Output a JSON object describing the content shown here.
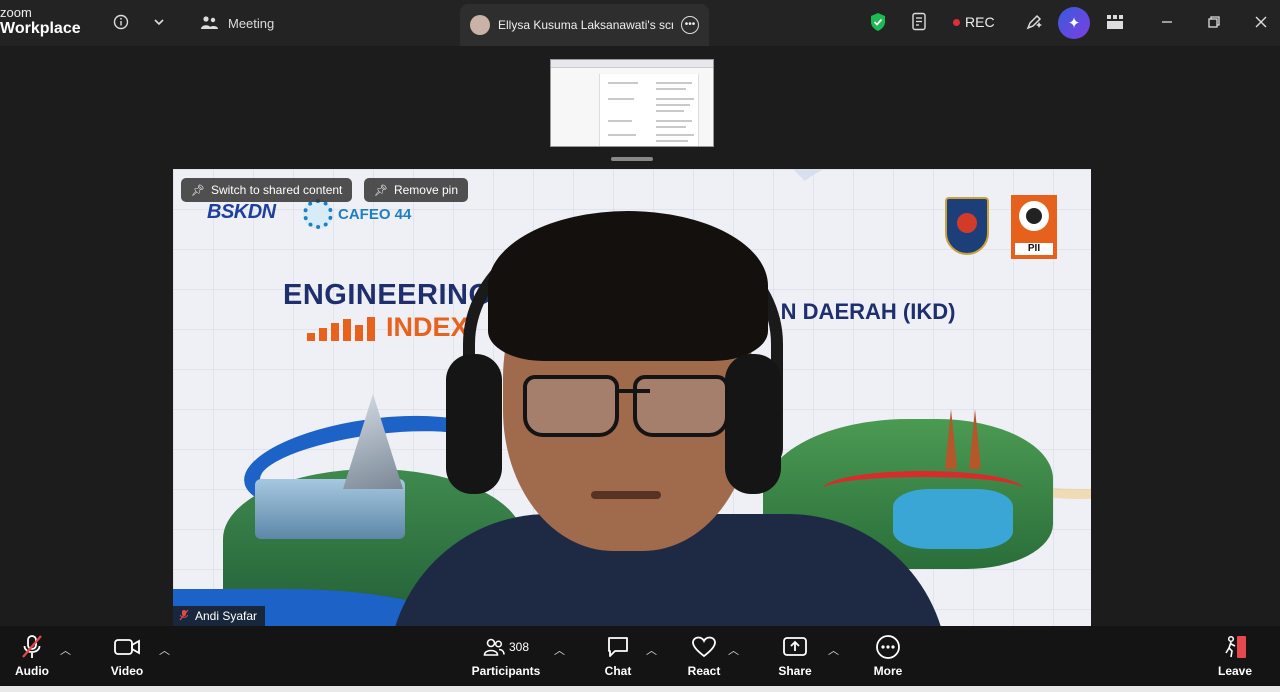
{
  "app": {
    "brand_line1": "zoom",
    "brand_line2": "Workplace"
  },
  "titlebar": {
    "meeting_tab_label": "Meeting",
    "share_tab_label": "Ellysa Kusuma Laksanawati's scree",
    "rec_label": "REC"
  },
  "video": {
    "switch_button": "Switch to shared content",
    "remove_pin_button": "Remove pin",
    "participant_name": "Andi Syafar",
    "slide": {
      "logo_bskdn": "BSKDN",
      "logo_cafeo": "CAFEO 44",
      "title_engineering": "ENGINEERING",
      "title_index": "INDEX",
      "title_ikd": "URAN DAERAH (IKD)",
      "pii_label": "PII"
    }
  },
  "toolbar": {
    "audio": "Audio",
    "video": "Video",
    "participants": "Participants",
    "participant_count": "308",
    "chat": "Chat",
    "react": "React",
    "share": "Share",
    "more": "More",
    "leave": "Leave"
  },
  "colors": {
    "accent_green": "#1db954",
    "rec_red": "#e02d3c",
    "mute_red": "#e04a4a",
    "leave_red": "#e5484d",
    "ai_gradient_start": "#3a5bd9",
    "ai_gradient_end": "#7b3fe4"
  }
}
